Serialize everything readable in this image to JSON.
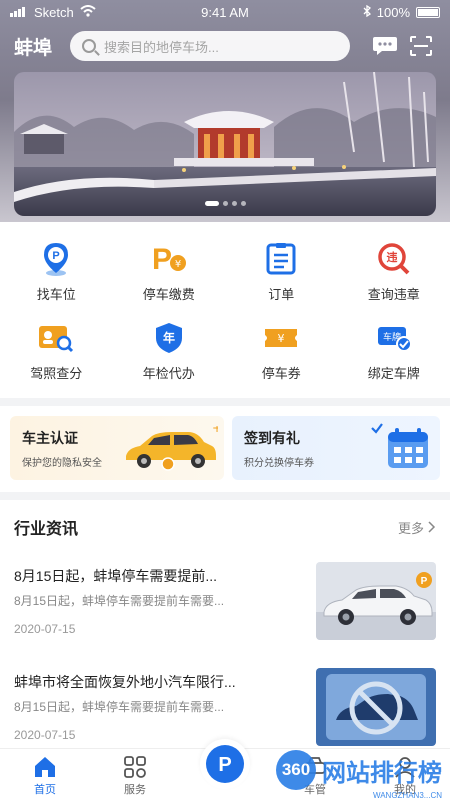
{
  "status_bar": {
    "carrier": "Sketch",
    "time": "9:41 AM",
    "battery": "100%"
  },
  "header": {
    "city": "蚌埠",
    "search_placeholder": "搜索目的地停车场..."
  },
  "banner": {
    "dot_count": 4,
    "active_index": 0
  },
  "services": [
    {
      "label": "找车位",
      "icon": "parking-pin-icon"
    },
    {
      "label": "停车缴费",
      "icon": "parking-pay-icon"
    },
    {
      "label": "订单",
      "icon": "order-list-icon"
    },
    {
      "label": "查询违章",
      "icon": "violation-search-icon"
    },
    {
      "label": "驾照查分",
      "icon": "license-score-icon"
    },
    {
      "label": "年检代办",
      "icon": "annual-inspection-icon"
    },
    {
      "label": "停车券",
      "icon": "parking-coupon-icon"
    },
    {
      "label": "绑定车牌",
      "icon": "bind-plate-icon"
    }
  ],
  "promos": [
    {
      "title": "车主认证",
      "subtitle": "保护您的隐私安全"
    },
    {
      "title": "签到有礼",
      "subtitle": "积分兑换停车券"
    }
  ],
  "news": {
    "title": "行业资讯",
    "more": "更多",
    "items": [
      {
        "headline": "8月15日起，蚌埠停车需要提前...",
        "desc": "8月15日起，蚌埠停车需要提前车需要...",
        "date": "2020-07-15"
      },
      {
        "headline": "蚌埠市将全面恢复外地小汽车限行...",
        "desc": "8月15日起，蚌埠停车需要提前车需要...",
        "date": "2020-07-15"
      }
    ]
  },
  "tabbar": [
    {
      "label": "首页",
      "active": true
    },
    {
      "label": "服务",
      "active": false
    },
    {
      "label": "车管",
      "active": false
    },
    {
      "label": "我的",
      "active": false
    }
  ],
  "watermark": {
    "logo": "360",
    "text": "网站排行榜",
    "sub": "WANGZHAN3...CN"
  },
  "colors": {
    "primary": "#1e6fe6",
    "accent_orange": "#f0a020",
    "accent_red": "#e0453a"
  }
}
